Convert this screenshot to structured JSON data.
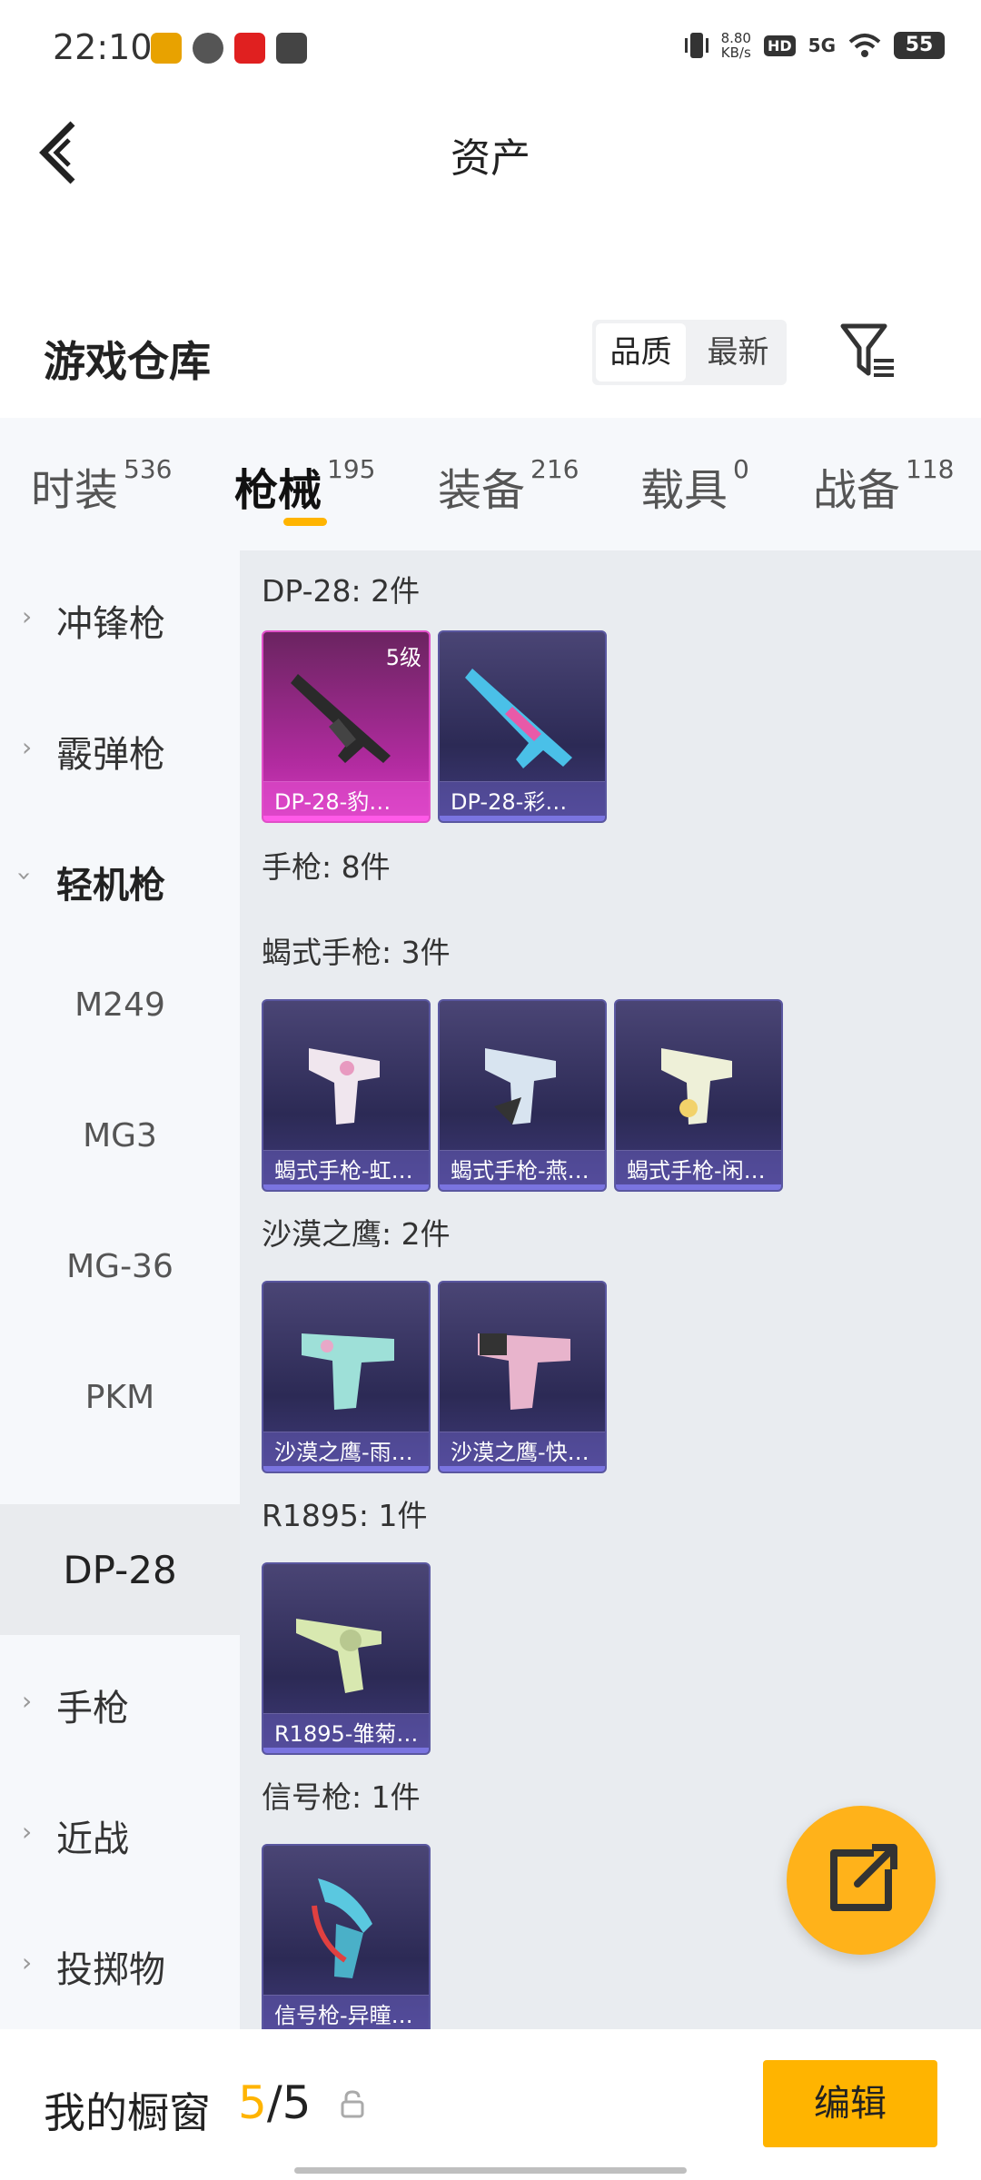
{
  "status": {
    "time": "22:10",
    "net_speed": "8.80",
    "net_unit": "KB/s",
    "hd": "HD",
    "signal": "5G",
    "battery": "55"
  },
  "header": {
    "title": "资产"
  },
  "warehouse": {
    "title": "游戏仓库",
    "sort_options": [
      "品质",
      "最新"
    ],
    "active_sort": "品质"
  },
  "tabs": [
    {
      "label": "时装",
      "count": "536"
    },
    {
      "label": "枪械",
      "count": "195",
      "active": true
    },
    {
      "label": "装备",
      "count": "216"
    },
    {
      "label": "载具",
      "count": "0"
    },
    {
      "label": "战备",
      "count": "118"
    }
  ],
  "sidebar": [
    {
      "label": "冲锋枪",
      "type": "category"
    },
    {
      "label": "霰弹枪",
      "type": "category"
    },
    {
      "label": "轻机枪",
      "type": "category",
      "expanded": true
    },
    {
      "label": "M249",
      "type": "sub"
    },
    {
      "label": "MG3",
      "type": "sub"
    },
    {
      "label": "MG-36",
      "type": "sub"
    },
    {
      "label": "PKM",
      "type": "sub"
    },
    {
      "label": "DP-28",
      "type": "sub",
      "selected": true
    },
    {
      "label": "手枪",
      "type": "category"
    },
    {
      "label": "近战",
      "type": "category"
    },
    {
      "label": "投掷物",
      "type": "category"
    }
  ],
  "groups": [
    {
      "title": "DP-28: 2件",
      "items": [
        {
          "name": "DP-28-豹…",
          "level": "5级",
          "rarity": "gold"
        },
        {
          "name": "DP-28-彩…",
          "rarity": "purple"
        }
      ]
    },
    {
      "title": "手枪: 8件",
      "items": []
    },
    {
      "title": "蝎式手枪: 3件",
      "items": [
        {
          "name": "蝎式手枪-虹…",
          "rarity": "purple"
        },
        {
          "name": "蝎式手枪-燕…",
          "rarity": "purple"
        },
        {
          "name": "蝎式手枪-闲…",
          "rarity": "purple"
        }
      ]
    },
    {
      "title": "沙漠之鹰: 2件",
      "items": [
        {
          "name": "沙漠之鹰-雨…",
          "rarity": "purple"
        },
        {
          "name": "沙漠之鹰-快…",
          "rarity": "purple"
        }
      ]
    },
    {
      "title": "R1895: 1件",
      "items": [
        {
          "name": "R1895-雏菊…",
          "rarity": "purple"
        }
      ]
    },
    {
      "title": "信号枪: 1件",
      "items": [
        {
          "name": "信号枪-异瞳…",
          "rarity": "purple"
        }
      ]
    }
  ],
  "bottom": {
    "showcase_label": "我的橱窗",
    "showcase_used": "5",
    "showcase_sep": "/",
    "showcase_total": "5",
    "edit_label": "编辑"
  },
  "colors": {
    "accent": "#ffb400",
    "fab": "#ffb21a"
  }
}
